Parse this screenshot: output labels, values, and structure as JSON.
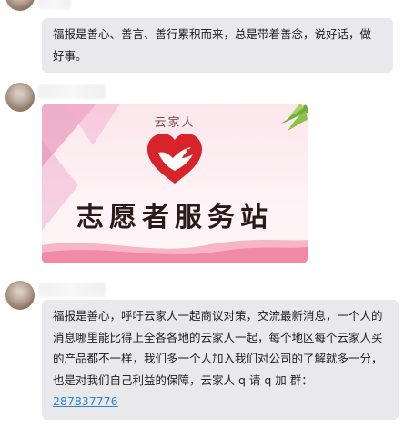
{
  "messages": [
    {
      "text": "福报是善心、善言、善行累积而来，总是带着善念，说好话，做好事。"
    },
    {
      "card": {
        "brand": "云家人",
        "title": "志愿者服务站",
        "icon": "heart-dove-icon"
      }
    },
    {
      "text": "福报是善心，呼吁云家人一起商议对策，交流最新消息，一个人的 消息哪里能比得上全各各地的云家人一起，每个地区每个云家人买的产品都不一样，我们多一个人加入我们对公司的了解就多一分，也是对我们自己利益的保障，云家人 q 请 q 加 群：",
      "link": "287837776"
    }
  ],
  "colors": {
    "bubble": "#e9e9eb",
    "link": "#2a86c9",
    "heart": "#d8232a"
  }
}
